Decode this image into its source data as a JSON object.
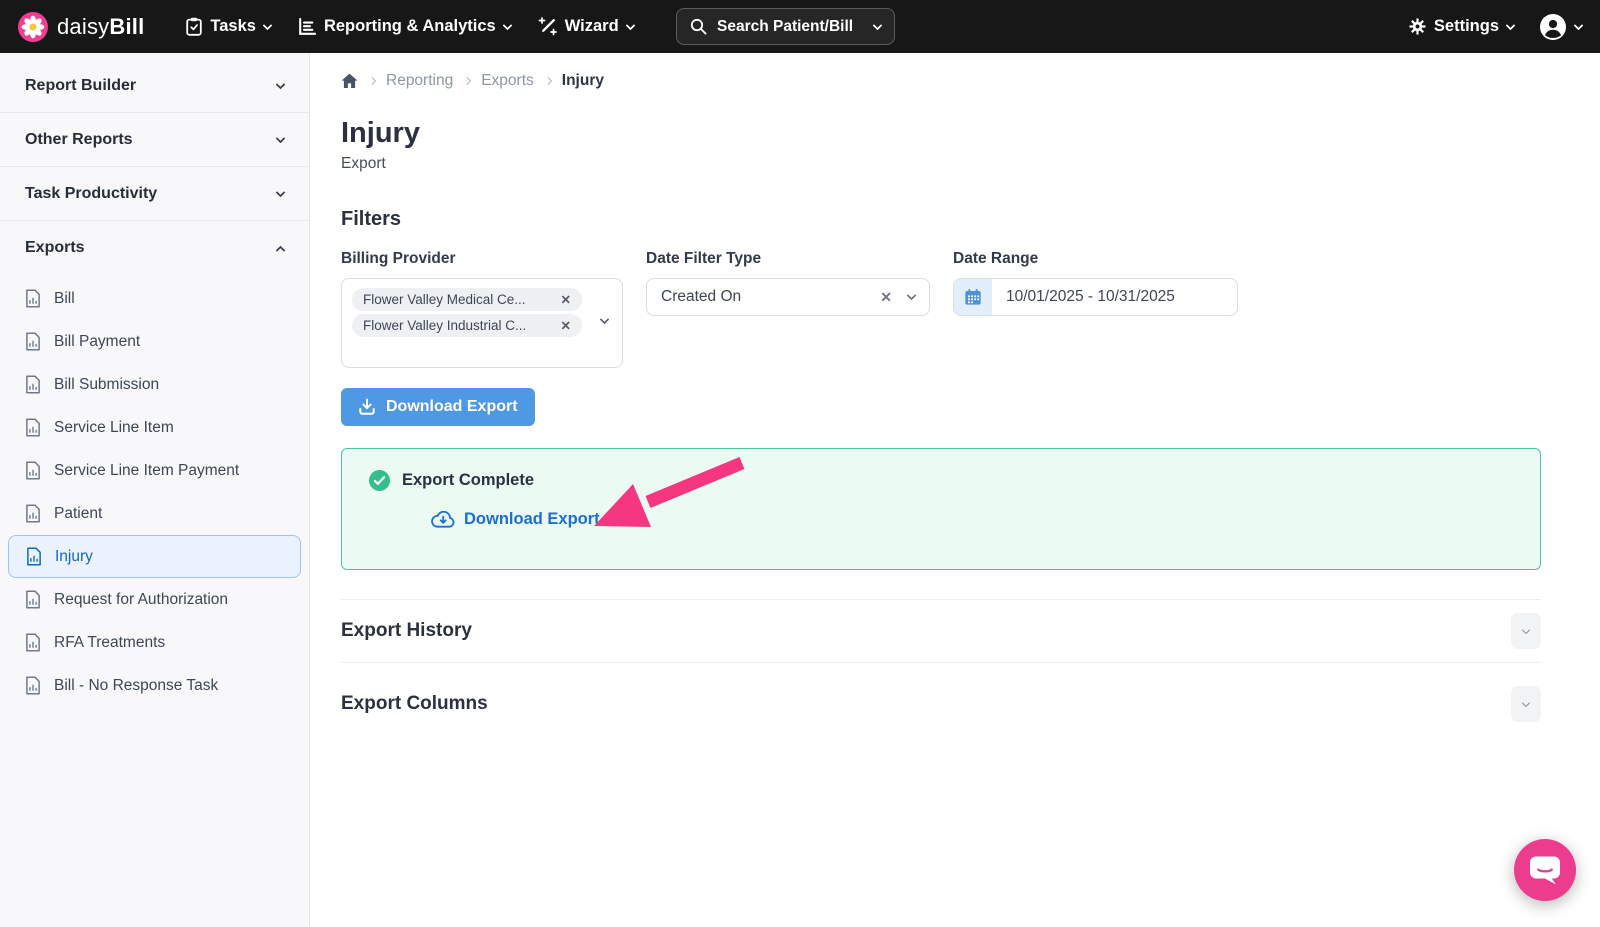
{
  "topnav": {
    "brand": {
      "part1": "daisy",
      "part2": "Bill"
    },
    "tasks_label": "Tasks",
    "reporting_label": "Reporting & Analytics",
    "wizard_label": "Wizard",
    "search_label": "Search Patient/Bill",
    "settings_label": "Settings"
  },
  "sidebar": {
    "sections": [
      {
        "label": "Report Builder",
        "expanded": false
      },
      {
        "label": "Other Reports",
        "expanded": false
      },
      {
        "label": "Task Productivity",
        "expanded": false
      },
      {
        "label": "Exports",
        "expanded": true
      }
    ],
    "exports_items": [
      {
        "label": "Bill"
      },
      {
        "label": "Bill Payment"
      },
      {
        "label": "Bill Submission"
      },
      {
        "label": "Service Line Item"
      },
      {
        "label": "Service Line Item Payment"
      },
      {
        "label": "Patient"
      },
      {
        "label": "Injury"
      },
      {
        "label": "Request for Authorization"
      },
      {
        "label": "RFA Treatments"
      },
      {
        "label": "Bill - No Response Task"
      }
    ],
    "selected_item": "Injury"
  },
  "breadcrumb": {
    "items": [
      {
        "label": "Reporting"
      },
      {
        "label": "Exports"
      },
      {
        "label": "Injury"
      }
    ]
  },
  "page": {
    "title": "Injury",
    "subtitle": "Export"
  },
  "filters": {
    "heading": "Filters",
    "billing_provider": {
      "label": "Billing Provider",
      "chips": [
        {
          "label": "Flower Valley Medical Ce..."
        },
        {
          "label": "Flower Valley Industrial C..."
        }
      ]
    },
    "date_filter_type": {
      "label": "Date Filter Type",
      "value": "Created On"
    },
    "date_range": {
      "label": "Date Range",
      "value": "10/01/2025 - 10/31/2025"
    }
  },
  "actions": {
    "download_button_label": "Download Export"
  },
  "export_complete": {
    "status": "Export Complete",
    "download_link_label": "Download Export"
  },
  "collapsible_sections": [
    {
      "label": "Export History"
    },
    {
      "label": "Export Columns"
    }
  ],
  "glyphs": {
    "remove": "✕",
    "clear": "✕"
  },
  "colors": {
    "brand_pink": "#f23d92",
    "arrow_pink": "#f5377f",
    "primary_blue": "#4f98e4",
    "link_blue": "#1b6fd3",
    "success_green": "#35bd8d",
    "panel_green_border": "#4fc39c",
    "panel_green_bg": "#ecfaf4",
    "selected_item_bg": "#e9f2fd",
    "selected_item_border": "#9cc5f0",
    "selected_item_text": "#1467c1",
    "topnav_bg": "#171717"
  }
}
